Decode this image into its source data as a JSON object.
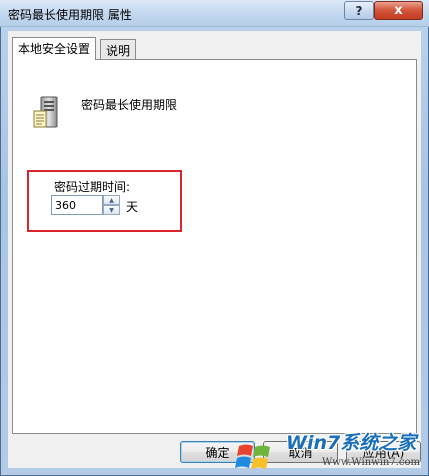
{
  "window": {
    "title": "密码最长使用期限 属性",
    "help_glyph": "?",
    "close_glyph": "x"
  },
  "tabs": [
    {
      "label": "本地安全设置",
      "active": true
    },
    {
      "label": "说明",
      "active": false
    }
  ],
  "policy": {
    "icon": "server-policy-icon",
    "name": "密码最长使用期限"
  },
  "setting": {
    "label": "密码过期时间:",
    "value": "360",
    "unit": "天",
    "highlight_color": "#d9262c"
  },
  "buttons": {
    "ok": "确定",
    "cancel": "取消",
    "apply": "应用(A)"
  },
  "watermark": {
    "logo": "windows-flag-icon",
    "text": "Win7系统之家",
    "url": "Www.Winwin7.com"
  },
  "colors": {
    "titlebar": "#c4d8ef",
    "close_button": "#d5573f",
    "panel_bg": "#f0f0f0"
  }
}
